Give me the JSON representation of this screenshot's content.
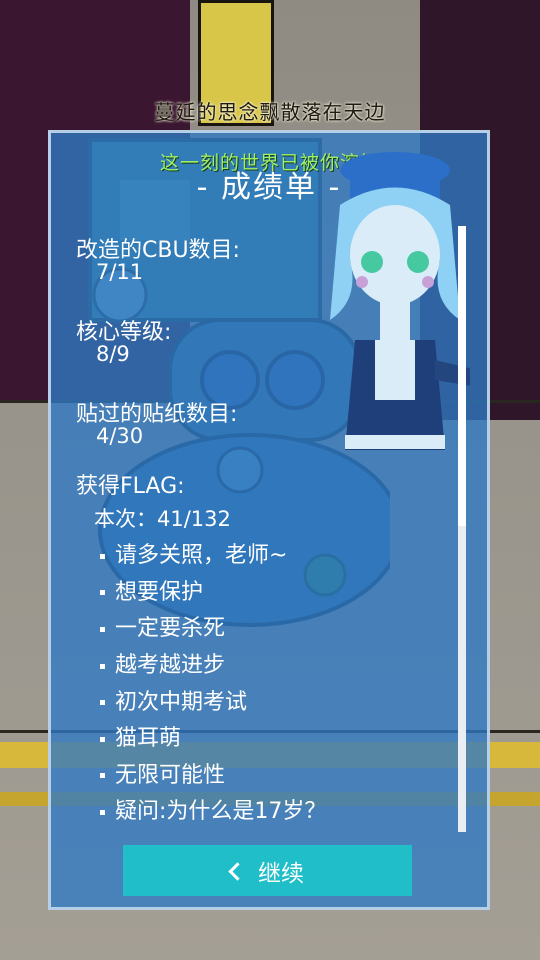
{
  "header": {
    "line1": "蔓延的思念飘散落在天边",
    "line2": "这一刻的世界已被你溶解"
  },
  "report": {
    "title": "- 成绩单 -",
    "stats": [
      {
        "label": "改造的CBU数目:",
        "value": "7/11"
      },
      {
        "label": "核心等级:",
        "value": "8/9"
      },
      {
        "label": "贴过的贴纸数目:",
        "value": "4/30"
      }
    ],
    "flags": {
      "label": "获得FLAG:",
      "count": "本次：41/132",
      "items": [
        "请多关照，老师~",
        "想要保护",
        "一定要杀死",
        "越考越进步",
        "初次中期考试",
        "猫耳萌",
        "无限可能性",
        "疑问:为什么是17岁？"
      ]
    }
  },
  "continue_button": {
    "icon": "chevron-left-icon",
    "label": "继续"
  },
  "colors": {
    "card": "#2f7ac4",
    "button": "#1fbec8",
    "accent_text": "#9cf06a"
  }
}
